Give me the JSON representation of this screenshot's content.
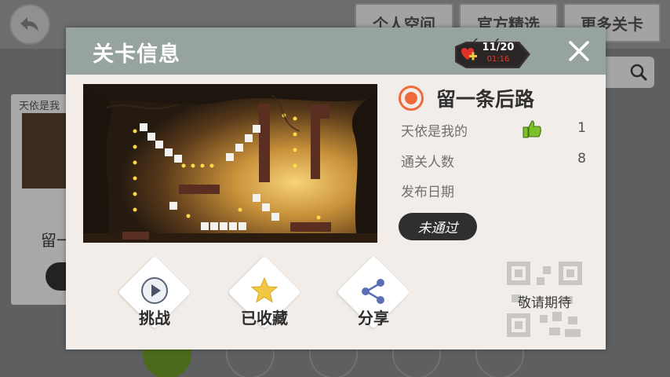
{
  "background": {
    "tabs": [
      "个人空间",
      "官方精选",
      "更多关卡"
    ],
    "card": {
      "title": "天依是我",
      "name": "留一"
    }
  },
  "modal": {
    "title": "关卡信息",
    "energy": {
      "count": "11/20",
      "timer": "01:16"
    },
    "level": {
      "name": "留一条后路",
      "rows": [
        {
          "label": "天依是我的",
          "value": "1",
          "icon": "thumbs-up-icon"
        },
        {
          "label": "通关人数",
          "value": "8"
        },
        {
          "label": "发布日期",
          "value": ""
        }
      ],
      "status": "未通过"
    },
    "actions": [
      {
        "label": "挑战",
        "icon": "play-icon"
      },
      {
        "label": "已收藏",
        "icon": "star-icon"
      },
      {
        "label": "分享",
        "icon": "share-icon"
      }
    ],
    "qr_label": "敬请期待"
  },
  "colors": {
    "header": "#97a3a1",
    "panel": "#f2ede8",
    "accent_orange": "#ef6b3d",
    "thumbs_green": "#7cc12a",
    "star_yellow": "#f2c744",
    "share_blue": "#5b6fb5"
  }
}
